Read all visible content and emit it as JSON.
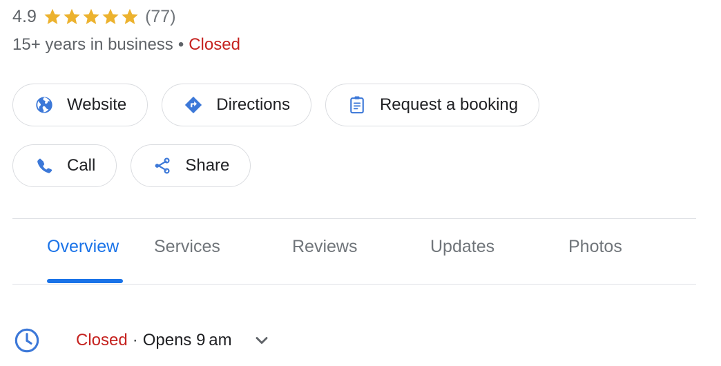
{
  "rating": {
    "value": "4.9",
    "stars_filled": 5,
    "star_color": "#ecb22e",
    "review_count": "(77)"
  },
  "subtitle": {
    "business_age": "15+ years in business",
    "separator": "•",
    "status": "Closed",
    "status_color": "#c5221f"
  },
  "actions": {
    "row1": [
      {
        "label": "Website",
        "icon": "globe-icon"
      },
      {
        "label": "Directions",
        "icon": "directions-diamond-icon"
      },
      {
        "label": "Request a booking",
        "icon": "clipboard-icon"
      }
    ],
    "row2": [
      {
        "label": "Call",
        "icon": "phone-icon"
      },
      {
        "label": "Share",
        "icon": "share-icon"
      }
    ]
  },
  "tabs": {
    "items": [
      {
        "label": "Overview",
        "active": true
      },
      {
        "label": "Services",
        "active": false
      },
      {
        "label": "Reviews",
        "active": false
      },
      {
        "label": "Updates",
        "active": false
      },
      {
        "label": "Photos",
        "active": false
      }
    ],
    "active_color": "#1a73e8",
    "inactive_color": "#70757a"
  },
  "hours": {
    "icon": "clock-icon",
    "status": "Closed",
    "separator": "·",
    "opens": "Opens 9 am",
    "expand_icon": "chevron-down-icon"
  },
  "colors": {
    "accent_blue": "#1a73e8",
    "icon_blue": "#3c78d8",
    "text_primary": "#202124",
    "text_secondary": "#5f6368",
    "border": "#dadce0"
  }
}
